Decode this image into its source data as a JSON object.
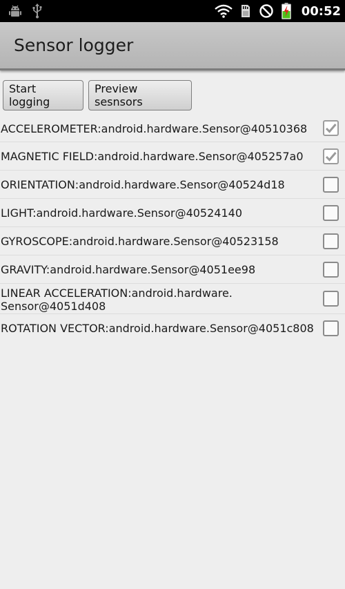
{
  "status_bar": {
    "time": "00:52",
    "icons": [
      "android-debug-icon",
      "usb-icon",
      "wifi-icon",
      "sd-card-icon",
      "do-not-disturb-icon",
      "battery-charging-icon"
    ]
  },
  "app": {
    "title": "Sensor logger"
  },
  "buttons": {
    "start_logging": "Start logging",
    "preview_sensors": "Preview sesnsors"
  },
  "sensors": [
    {
      "label": "ACCELEROMETER:android.hardware.Sensor@40510368",
      "checked": true
    },
    {
      "label": "MAGNETIC FIELD:android.hardware.Sensor@405257a0",
      "checked": true
    },
    {
      "label": "ORIENTATION:android.hardware.Sensor@40524d18",
      "checked": false
    },
    {
      "label": "LIGHT:android.hardware.Sensor@40524140",
      "checked": false
    },
    {
      "label": "GYROSCOPE:android.hardware.Sensor@40523158",
      "checked": false
    },
    {
      "label": "GRAVITY:android.hardware.Sensor@4051ee98",
      "checked": false
    },
    {
      "label": "LINEAR ACCELERATION:android.hardware.\nSensor@4051d408",
      "checked": false
    },
    {
      "label": "ROTATION VECTOR:android.hardware.Sensor@4051c808",
      "checked": false
    }
  ],
  "colors": {
    "status_bar_bg": "#000000",
    "title_bar_bg": "#bdbdbd",
    "background": "#eeeeee",
    "check_mark": "#9a9a9a"
  }
}
